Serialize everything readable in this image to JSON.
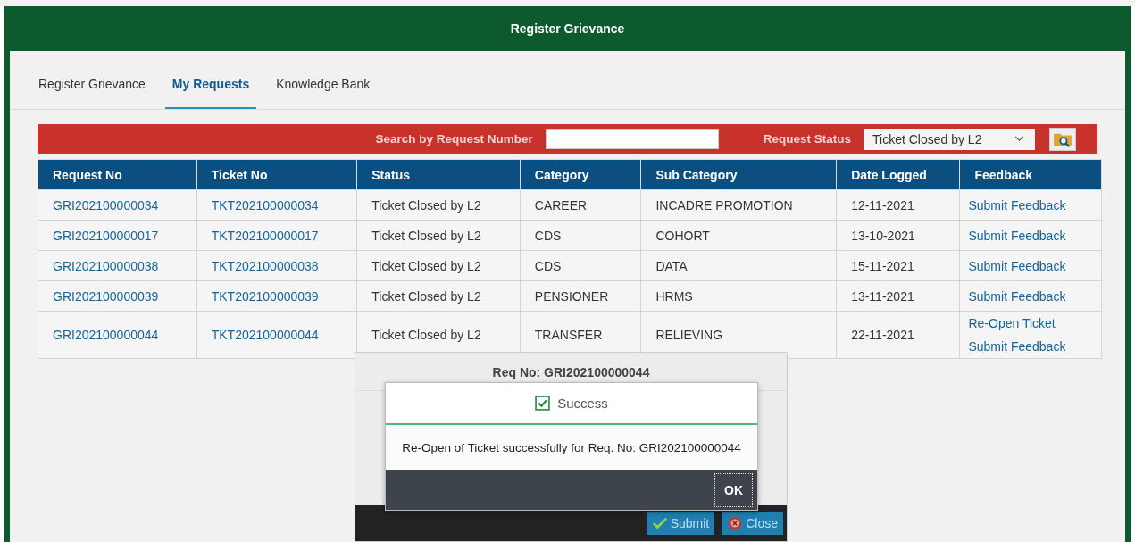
{
  "window": {
    "title": "Register Grievance"
  },
  "tabs": [
    {
      "label": "Register Grievance",
      "selected": false
    },
    {
      "label": "My Requests",
      "selected": true
    },
    {
      "label": "Knowledge Bank",
      "selected": false
    }
  ],
  "search": {
    "label": "Search by Request Number",
    "status_label": "Request Status",
    "status_value": "Ticket Closed by L2"
  },
  "table": {
    "columns": [
      "Request No",
      "Ticket No",
      "Status",
      "Category",
      "Sub Category",
      "Date Logged",
      "Feedback"
    ],
    "rows": [
      {
        "request_no": "GRI202100000034",
        "ticket_no": "TKT202100000034",
        "status": "Ticket Closed by L2",
        "category": "CAREER",
        "sub_category": "INCADRE PROMOTION",
        "date_logged": "12-11-2021",
        "feedback": [
          "Submit Feedback"
        ]
      },
      {
        "request_no": "GRI202100000017",
        "ticket_no": "TKT202100000017",
        "status": "Ticket Closed by L2",
        "category": "CDS",
        "sub_category": "COHORT",
        "date_logged": "13-10-2021",
        "feedback": [
          "Submit Feedback"
        ]
      },
      {
        "request_no": "GRI202100000038",
        "ticket_no": "TKT202100000038",
        "status": "Ticket Closed by L2",
        "category": "CDS",
        "sub_category": "DATA",
        "date_logged": "15-11-2021",
        "feedback": [
          "Submit Feedback"
        ]
      },
      {
        "request_no": "GRI202100000039",
        "ticket_no": "TKT202100000039",
        "status": "Ticket Closed by L2",
        "category": "PENSIONER",
        "sub_category": "HRMS",
        "date_logged": "13-11-2021",
        "feedback": [
          "Submit Feedback"
        ]
      },
      {
        "request_no": "GRI202100000044",
        "ticket_no": "TKT202100000044",
        "status": "Ticket Closed by L2",
        "category": "TRANSFER",
        "sub_category": "RELIEVING",
        "date_logged": "22-11-2021",
        "feedback": [
          "Re-Open Ticket",
          "Submit Feedback"
        ]
      }
    ]
  },
  "request_dialog": {
    "title": "Req No: GRI202100000044",
    "buttons": [
      {
        "label": "Submit",
        "kind": "submit"
      },
      {
        "label": "Close",
        "kind": "close"
      }
    ]
  },
  "alert": {
    "title": "Success",
    "message": "Re-Open of Ticket successfully for Req. No: GRI202100000044",
    "button": "OK"
  }
}
